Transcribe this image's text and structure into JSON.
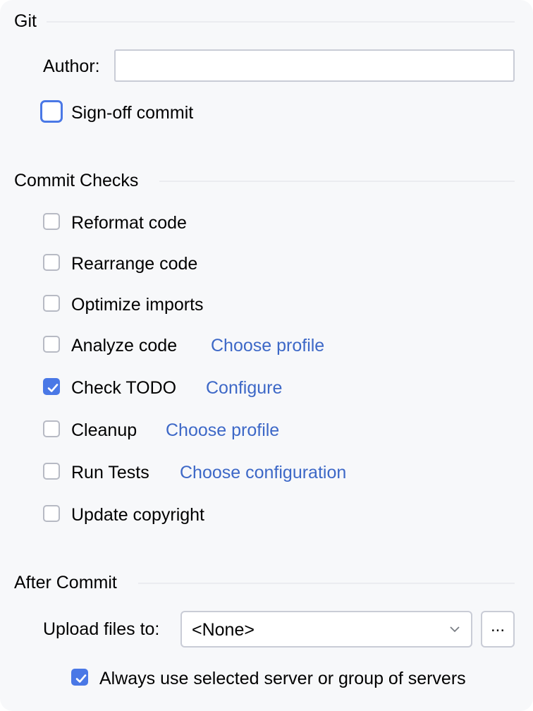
{
  "git": {
    "title": "Git",
    "author_label": "Author:",
    "author_value": "",
    "signoff": {
      "label": "Sign-off commit",
      "checked": false
    }
  },
  "commit_checks": {
    "title": "Commit Checks",
    "items": [
      {
        "label": "Reformat code",
        "checked": false,
        "link": ""
      },
      {
        "label": "Rearrange code",
        "checked": false,
        "link": ""
      },
      {
        "label": "Optimize imports",
        "checked": false,
        "link": ""
      },
      {
        "label": "Analyze code",
        "checked": false,
        "link": "Choose profile"
      },
      {
        "label": "Check TODO",
        "checked": true,
        "link": "Configure"
      },
      {
        "label": "Cleanup",
        "checked": false,
        "link": "Choose profile"
      },
      {
        "label": "Run Tests",
        "checked": false,
        "link": "Choose configuration"
      },
      {
        "label": "Update copyright",
        "checked": false,
        "link": ""
      }
    ]
  },
  "after_commit": {
    "title": "After Commit",
    "upload_label": "Upload files to:",
    "upload_value": "<None>",
    "browse_label": "...",
    "always_use": {
      "label": "Always use selected server or group of servers",
      "checked": true
    }
  },
  "colors": {
    "accent": "#4a78e6",
    "link": "#3d68c7",
    "background": "#f7f8fa"
  }
}
